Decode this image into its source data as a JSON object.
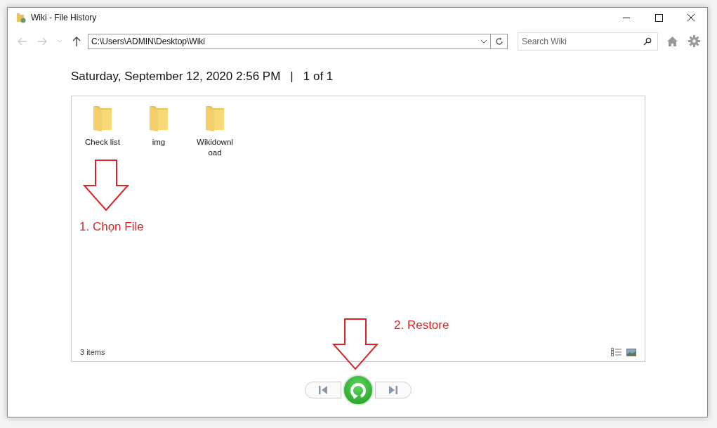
{
  "window": {
    "title": "Wiki - File History"
  },
  "address_bar": {
    "value": "C:\\Users\\ADMIN\\Desktop\\Wiki"
  },
  "search": {
    "placeholder": "Search Wiki"
  },
  "snapshot": {
    "date": "Saturday, September 12, 2020 2:56 PM",
    "separator": "|",
    "position": "1 of 1"
  },
  "items": [
    {
      "name": "Check list"
    },
    {
      "name": "img"
    },
    {
      "name": "Wikidownload"
    }
  ],
  "status_bar": {
    "count": "3 items"
  },
  "annotations": [
    {
      "text": "1. Chọn File"
    },
    {
      "text": "2. Restore"
    }
  ]
}
